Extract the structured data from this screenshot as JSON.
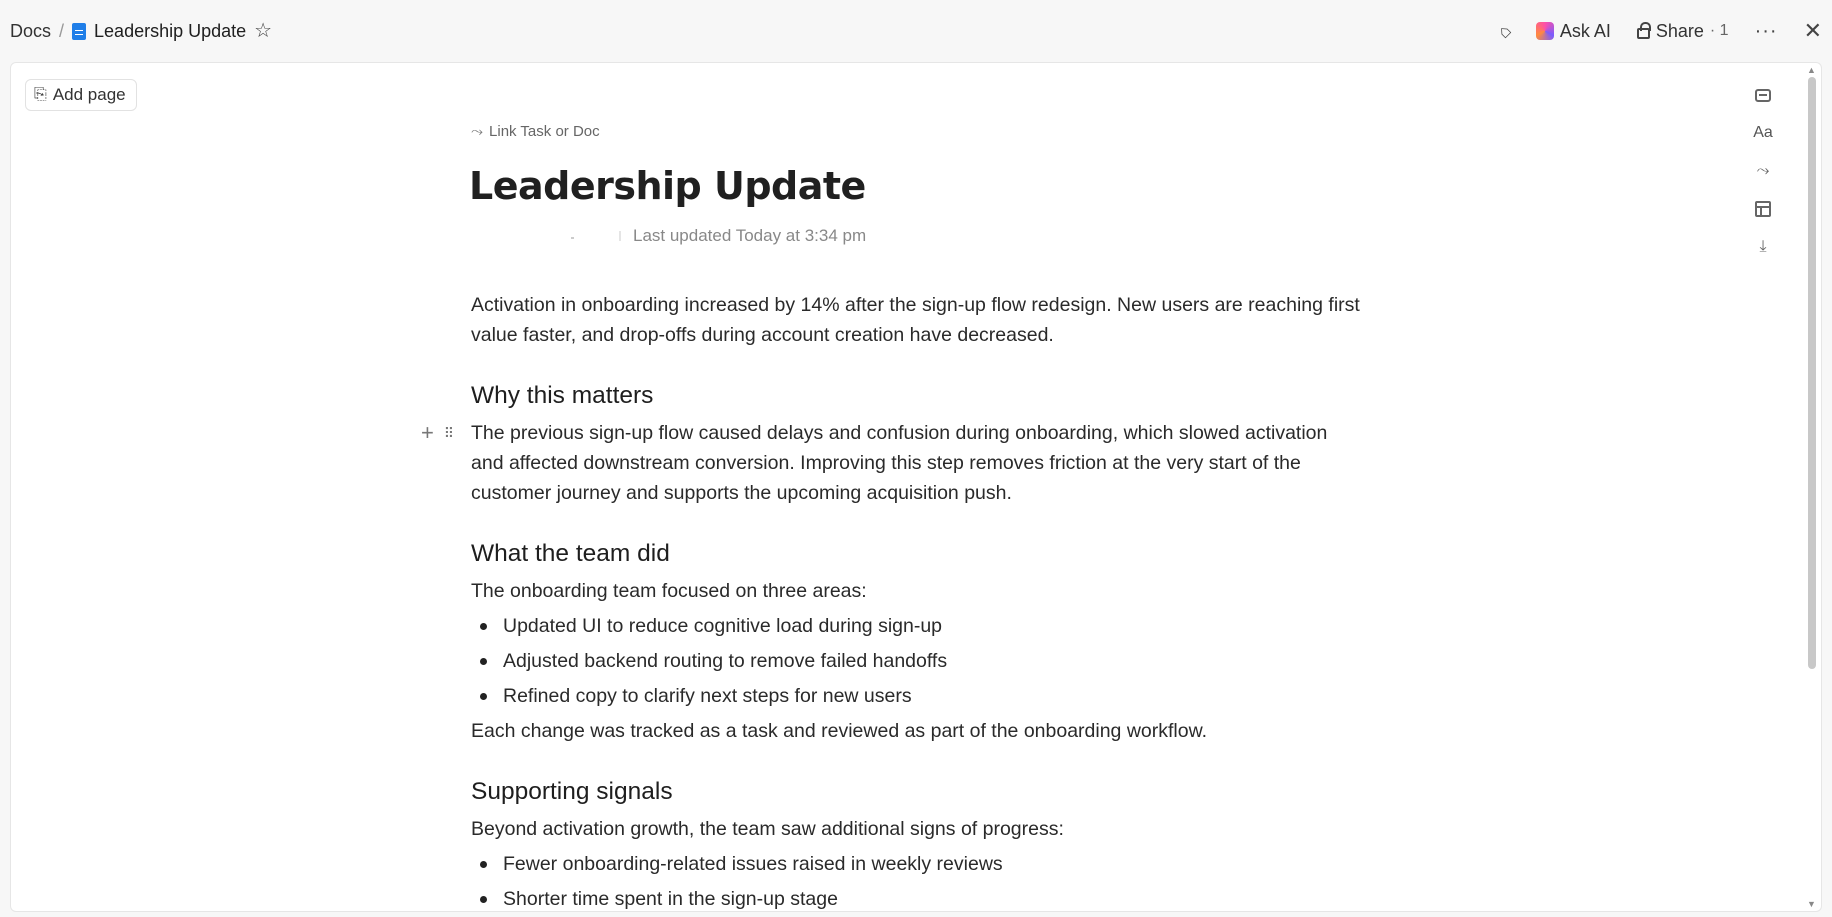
{
  "breadcrumb": {
    "root": "Docs",
    "separator": "/",
    "doc_title": "Leadership Update"
  },
  "header_actions": {
    "ask_ai": "Ask AI",
    "share": "Share",
    "share_count": "· 1"
  },
  "sidebar": {
    "add_page": "Add page"
  },
  "doc": {
    "link_task": "Link Task or Doc",
    "title": "Leadership Update",
    "last_updated": "Last updated Today at 3:34 pm",
    "intro": "Activation in onboarding increased by 14% after the sign-up flow redesign. New users are reaching first value faster, and drop-offs during account creation have decreased.",
    "sections": [
      {
        "heading": "Why this matters",
        "paragraph": "The previous sign-up flow caused delays and confusion during onboarding, which slowed activation and affected downstream conversion. Improving this step removes friction at the very start of the customer journey and supports the upcoming acquisition push."
      },
      {
        "heading": "What the team did",
        "lead": "The onboarding team focused on three areas:",
        "bullets": [
          "Updated UI to reduce cognitive load during sign-up",
          "Adjusted backend routing to remove failed handoffs",
          "Refined copy to clarify next steps for new users"
        ],
        "after": "Each change was tracked as a task and reviewed as part of the onboarding workflow."
      },
      {
        "heading": "Supporting signals",
        "lead": "Beyond activation growth, the team saw additional signs of progress:",
        "bullets": [
          "Fewer onboarding-related issues raised in weekly reviews",
          "Shorter time spent in the sign-up stage"
        ]
      }
    ]
  },
  "rail": {
    "font_label": "Aa"
  },
  "icons": [
    "doc-icon",
    "star-icon",
    "tag-icon",
    "ai-sparkle-icon",
    "lock-icon",
    "more-icon",
    "close-icon",
    "add-page-icon",
    "link-icon",
    "plus-icon",
    "drag-handle-icon",
    "comment-icon",
    "font-icon",
    "relationship-icon",
    "layout-icon",
    "download-icon"
  ],
  "colors": {
    "doc_icon": "#1f7ee8",
    "background": "#f7f7f7",
    "card": "#ffffff"
  }
}
